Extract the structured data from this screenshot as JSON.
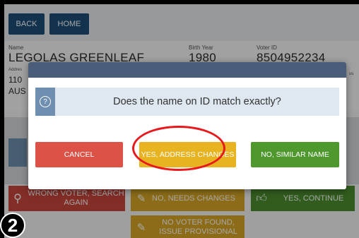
{
  "nav": {
    "back_label": "BACK",
    "home_label": "HOME"
  },
  "voter": {
    "name_label": "Name",
    "name_value": "LEGOLAS GREENLEAF",
    "birth_year_label": "Birth Year",
    "birth_year_value": "1980",
    "voter_id_label": "Voter ID",
    "voter_id_value": "8504952234",
    "address_label": "Addres",
    "address_line1_partial": "110",
    "address_line2_partial": "AUS",
    "status_label_partial": "us"
  },
  "modal": {
    "question": "Does the name on ID match exactly?",
    "cancel_label": "CANCEL",
    "yes_address_label": "YES, ADDRESS CHANGES",
    "no_similar_label": "NO, SIMILAR NAME"
  },
  "actions": {
    "wrong_voter_label": "WRONG VOTER, SEARCH AGAIN",
    "needs_changes_label": "NO, NEEDS CHANGES",
    "continue_label": "YES, CONTINUE",
    "provisional_label": "NO VOTER FOUND, ISSUE PROVISIONAL"
  },
  "step_badge": "2",
  "colors": {
    "nav_blue": "#1d4d79",
    "cancel_red": "#dd5246",
    "yes_yellow": "#e7b321",
    "no_green": "#4f982e",
    "highlight_ring": "#e8191d"
  }
}
